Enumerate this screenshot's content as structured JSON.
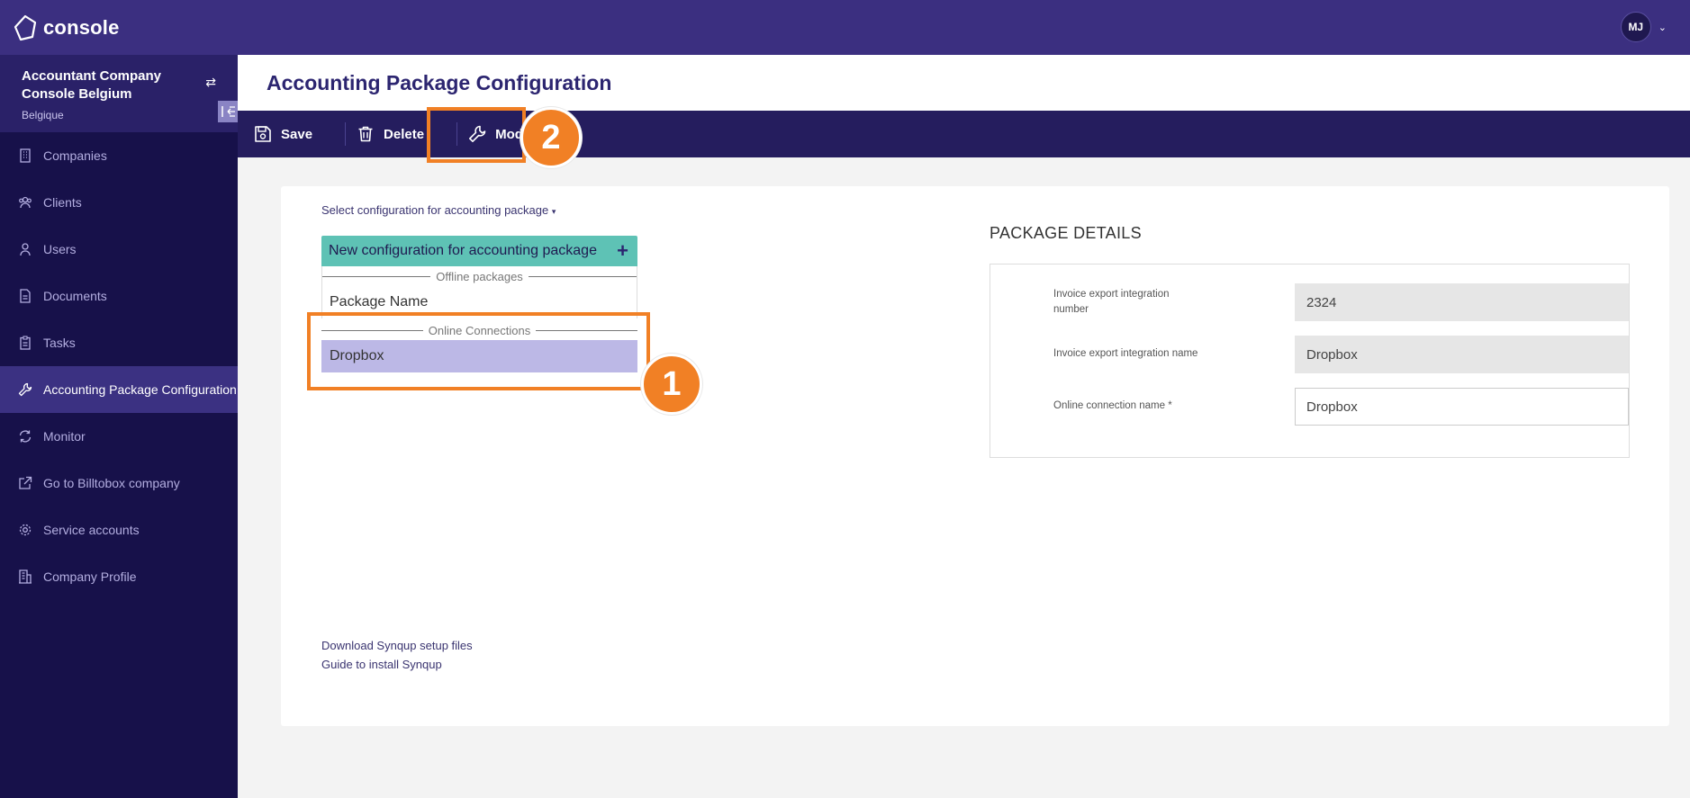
{
  "header": {
    "logo_text": "console",
    "user_initials": "MJ"
  },
  "sidebar": {
    "company_name": "Accountant Company Console Belgium",
    "company_country": "Belgique",
    "items": [
      {
        "label": "Companies"
      },
      {
        "label": "Clients"
      },
      {
        "label": "Users"
      },
      {
        "label": "Documents"
      },
      {
        "label": "Tasks"
      },
      {
        "label": "Accounting Package Configuration",
        "active": true
      },
      {
        "label": "Monitor"
      },
      {
        "label": "Go to Billtobox company"
      },
      {
        "label": "Service accounts"
      },
      {
        "label": "Company Profile"
      }
    ]
  },
  "page": {
    "title": "Accounting Package Configuration"
  },
  "toolbar": {
    "save_label": "Save",
    "delete_label": "Delete",
    "modify_label": "Modify"
  },
  "annotations": {
    "badge1": "1",
    "badge2": "2",
    "highlight_color": "#f18025"
  },
  "config": {
    "select_label": "Select configuration for accounting package",
    "new_config_label": "New configuration for accounting package",
    "offline_header": "Offline packages",
    "offline_items": [
      "Package Name"
    ],
    "online_header": "Online Connections",
    "online_items": [
      "Dropbox"
    ]
  },
  "package_details": {
    "title": "PACKAGE DETAILS",
    "fields": [
      {
        "label": "Invoice export integration number",
        "value": "2324",
        "editable": false
      },
      {
        "label": "Invoice export integration name",
        "value": "Dropbox",
        "editable": false
      },
      {
        "label": "Online connection name *",
        "value": "Dropbox",
        "editable": true
      }
    ]
  },
  "links": {
    "download": "Download Synqup setup files",
    "guide": "Guide to install Synqup"
  },
  "colors": {
    "topbar": "#3b2f80",
    "sidebar": "#17114a",
    "accent_teal": "#5ec2b5",
    "selected": "#bcb8e6"
  }
}
